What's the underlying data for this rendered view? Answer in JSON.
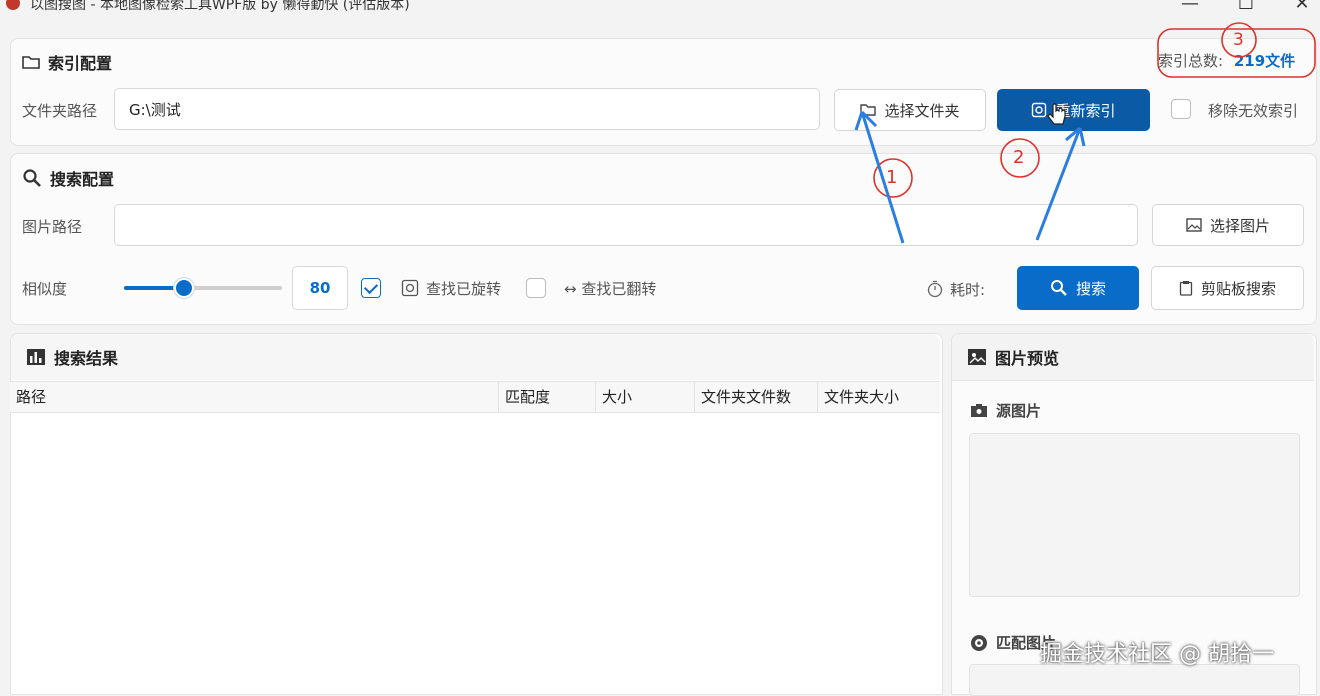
{
  "window": {
    "title": "以图搜图 - 本地图像检索工具WPF版 by 懒得勤快 (评估版本)",
    "minimize": "—",
    "maximize": "☐",
    "close": "✕"
  },
  "index_config": {
    "title": "索引配置",
    "folder_label": "文件夹路径",
    "folder_value": "G:\\测试",
    "select_folder_button": "选择文件夹",
    "reindex_button": "重新索引",
    "remove_invalid_label": "移除无效索引",
    "total_label": "索引总数:",
    "total_value": "219文件"
  },
  "search_config": {
    "title": "搜索配置",
    "image_path_label": "图片路径",
    "image_path_value": "",
    "select_image_button": "选择图片",
    "similarity_label": "相似度",
    "similarity_value": "80",
    "similarity_percent": 38,
    "find_rotated_label": "查找已旋转",
    "find_rotated_checked": true,
    "find_flipped_label": "↔ 查找已翻转",
    "find_flipped_checked": false,
    "elapsed_label": "耗时:",
    "search_button": "搜索",
    "clipboard_search_button": "剪贴板搜索"
  },
  "results": {
    "title": "搜索结果",
    "columns": [
      "路径",
      "匹配度",
      "大小",
      "文件夹文件数",
      "文件夹大小"
    ]
  },
  "preview": {
    "title": "图片预览",
    "source_label": "源图片",
    "match_label": "匹配图片"
  },
  "annotations": [
    "1",
    "2",
    "3"
  ],
  "watermark": "掘金技术社区 @ 胡拾一",
  "colors": {
    "accent": "#0a6cc9",
    "annotation_red": "#e0322b",
    "arrow_blue": "#2a7de1"
  }
}
